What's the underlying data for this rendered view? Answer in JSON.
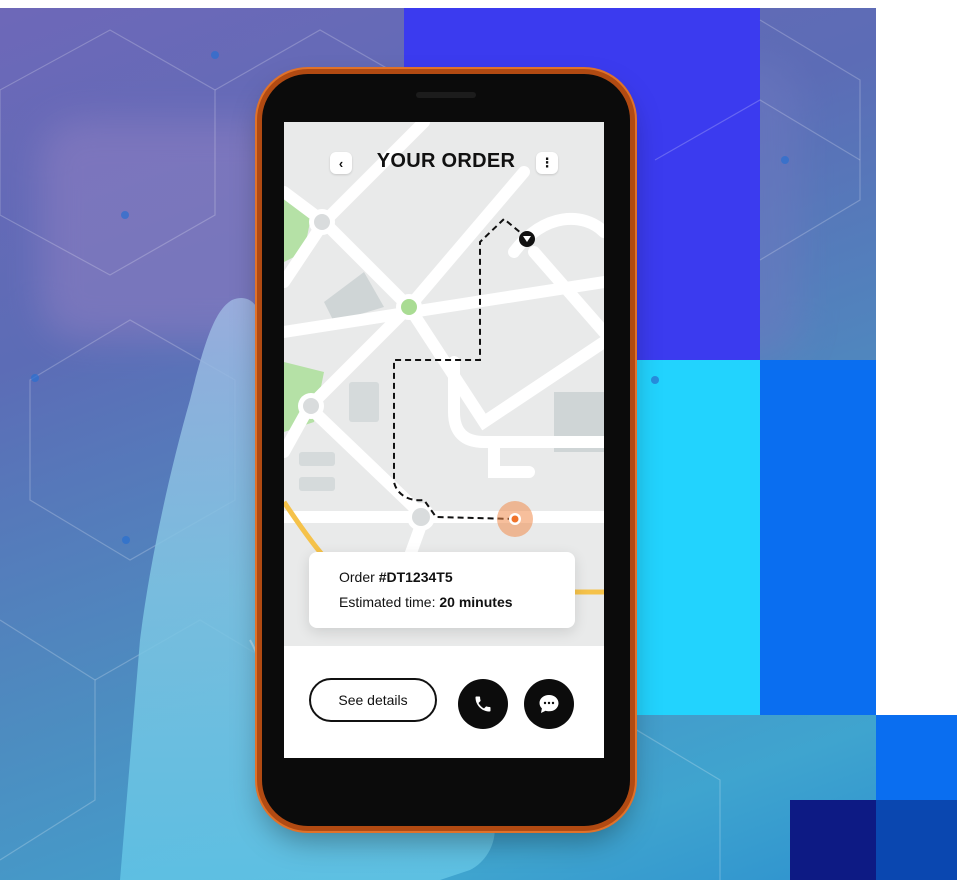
{
  "app": {
    "title": "YOUR ORDER"
  },
  "header": {
    "back_icon": "chevron-left-icon",
    "more_icon": "more-vertical-icon"
  },
  "order_card": {
    "order_prefix": "Order",
    "order_id": "#DT1234T5",
    "eta_prefix": "Estimated time:",
    "eta_value": "20 minutes"
  },
  "actions": {
    "details_label": "See details",
    "call_icon": "phone-icon",
    "chat_icon": "chat-bubble-icon"
  },
  "colors": {
    "accent_blue": "#3b3bef",
    "cyan": "#22d3fe",
    "blue": "#0a6ef0",
    "navy": "#0d1a84",
    "phone_frame": "#c55a1c",
    "destination_marker": "#f08a4b",
    "park_green": "#b5e1a6"
  }
}
